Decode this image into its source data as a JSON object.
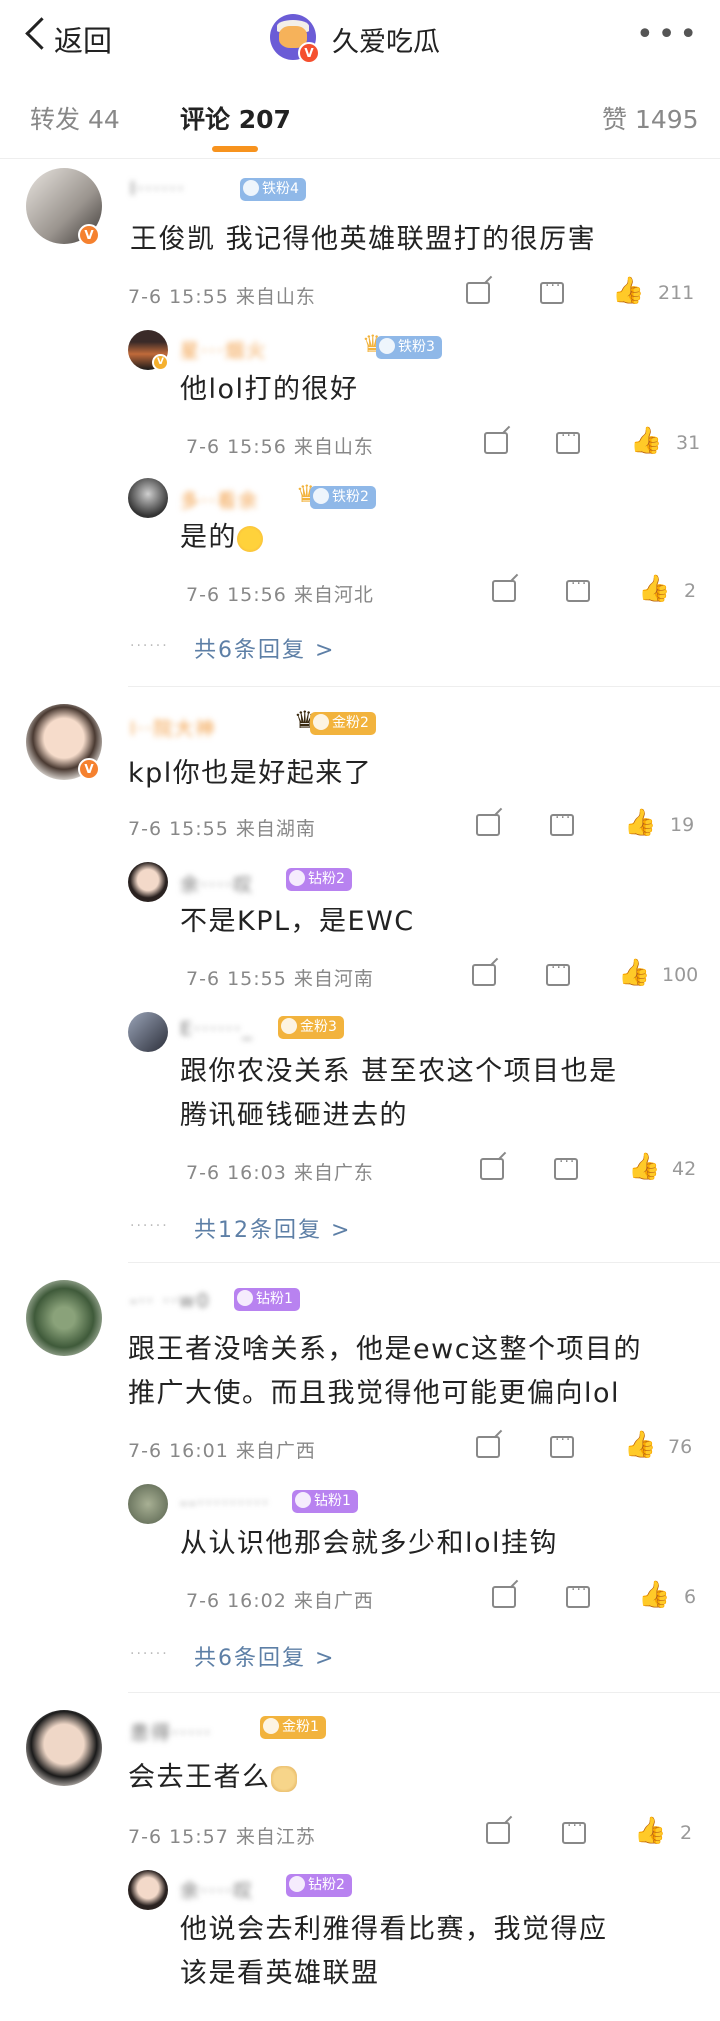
{
  "header": {
    "back_label": "返回",
    "title": "久爱吃瓜",
    "more": "•••",
    "verified": "V"
  },
  "tabs": [
    {
      "label": "转发 44"
    },
    {
      "label": "评论 207"
    },
    {
      "label": "赞 1495"
    }
  ],
  "comments": [
    {
      "badge": "铁粉4",
      "content": "王俊凯 我记得他英雄联盟打的很厉害",
      "meta": "7-6 15:55 来自山东",
      "likes": "211",
      "replies": [
        {
          "badge": "铁粉3",
          "content": "他lol打的很好",
          "meta": "7-6 15:56 来自山东",
          "likes": "31"
        },
        {
          "badge": "铁粉2",
          "content": "是的",
          "meta": "7-6 15:56 来自河北",
          "likes": "2"
        }
      ],
      "more": "共6条回复 >"
    },
    {
      "badge": "金粉2",
      "content": "kpl你也是好起来了",
      "meta": "7-6 15:55 来自湖南",
      "likes": "19",
      "replies": [
        {
          "badge": "钻粉2",
          "content": "不是KPL，是EWC",
          "meta": "7-6 15:55 来自河南",
          "likes": "100"
        },
        {
          "badge": "金粉3",
          "content_l1": "跟你农没关系 甚至农这个项目也是",
          "content_l2": "腾讯砸钱砸进去的",
          "meta": "7-6 16:03 来自广东",
          "likes": "42"
        }
      ],
      "more": "共12条回复 >"
    },
    {
      "badge": "钻粉1",
      "content_l1": "跟王者没啥关系，他是ewc这整个项目的",
      "content_l2": "推广大使。而且我觉得他可能更偏向lol",
      "meta": "7-6 16:01 来自广西",
      "likes": "76",
      "replies": [
        {
          "badge": "钻粉1",
          "content": "从认识他那会就多少和lol挂钩",
          "meta": "7-6 16:02 来自广西",
          "likes": "6"
        }
      ],
      "more": "共6条回复 >"
    },
    {
      "badge": "金粉1",
      "content": "会去王者么",
      "meta": "7-6 15:57 来自江苏",
      "likes": "2",
      "replies": [
        {
          "badge": "钻粉2",
          "content_l1": "他说会去利雅得看比赛，我觉得应",
          "content_l2": "该是看英雄联盟"
        }
      ]
    }
  ]
}
